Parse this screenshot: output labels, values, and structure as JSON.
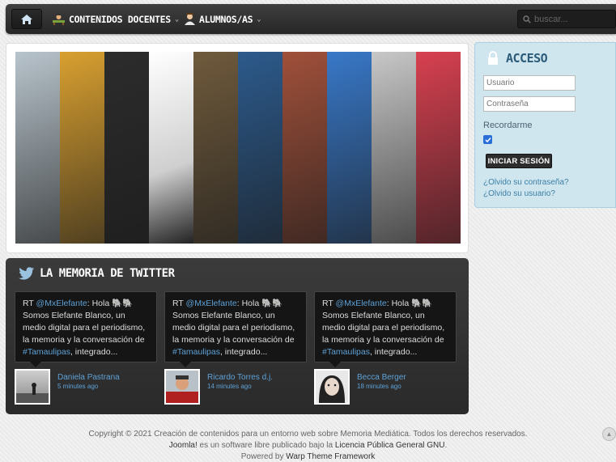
{
  "nav": {
    "home_icon": "home-icon",
    "items": [
      {
        "label": "CONTENIDOS DOCENTES",
        "icon": "teacher-icon"
      },
      {
        "label": "ALUMNOS/AS",
        "icon": "student-icon"
      }
    ],
    "search_placeholder": "buscar..."
  },
  "banner": {
    "strip_colors": [
      "#b8c4cc",
      "#d9a030",
      "#2c2c2c",
      "#f0f0f0",
      "#6f5a3c",
      "#2c5a8c",
      "#a0503a",
      "#3878c8",
      "#c8c8c8",
      "#d84050"
    ]
  },
  "login": {
    "title": "ACCESO",
    "icon": "lock-icon",
    "username_placeholder": "Usuario",
    "password_placeholder": "Contraseña",
    "remember_label": "Recordarme",
    "remember_checked": true,
    "submit_label": "INICIAR SESIÓN",
    "forgot_password": "¿Olvido su contraseña?",
    "forgot_username": "¿Olvido su usuario?"
  },
  "twitter": {
    "title": "LA MEMORIA DE TWITTER",
    "icon": "twitter-bird-icon",
    "tweets": [
      {
        "rt": "RT",
        "handle": "@MxElefante",
        "text1": ": Hola 🐘🐘",
        "text2": "Somos Elefante Blanco, un medio digital para el periodismo, la memoria y la conversación de ",
        "tag": "#Tamaulipas",
        "text3": ", integrado...",
        "user": "Daniela Pastrana",
        "time": "5 minutes ago"
      },
      {
        "rt": "RT",
        "handle": "@MxElefante",
        "text1": ": Hola 🐘🐘",
        "text2": "Somos Elefante Blanco, un medio digital para el periodismo, la memoria y la conversación de ",
        "tag": "#Tamaulipas",
        "text3": ", integrado...",
        "user": "Ricardo Torres d.j.",
        "time": "14 minutes ago"
      },
      {
        "rt": "RT",
        "handle": "@MxElefante",
        "text1": ": Hola 🐘🐘",
        "text2": "Somos Elefante Blanco, un medio digital para el periodismo, la memoria y la conversación de ",
        "tag": "#Tamaulipas",
        "text3": ", integrado...",
        "user": "Becca Berger",
        "time": "18 minutes ago"
      }
    ]
  },
  "footer": {
    "line1": "Copyright © 2021 Creación de contenidos para un entorno web sobre Memoria Mediática. Todos los derechos reservados.",
    "line2a": "Joomla!",
    "line2b": " es un software libre publicado bajo la ",
    "line2c": "Licencia Pública General GNU",
    "line2d": ".",
    "line3a": "Powered by ",
    "line3b": "Warp Theme Framework"
  }
}
